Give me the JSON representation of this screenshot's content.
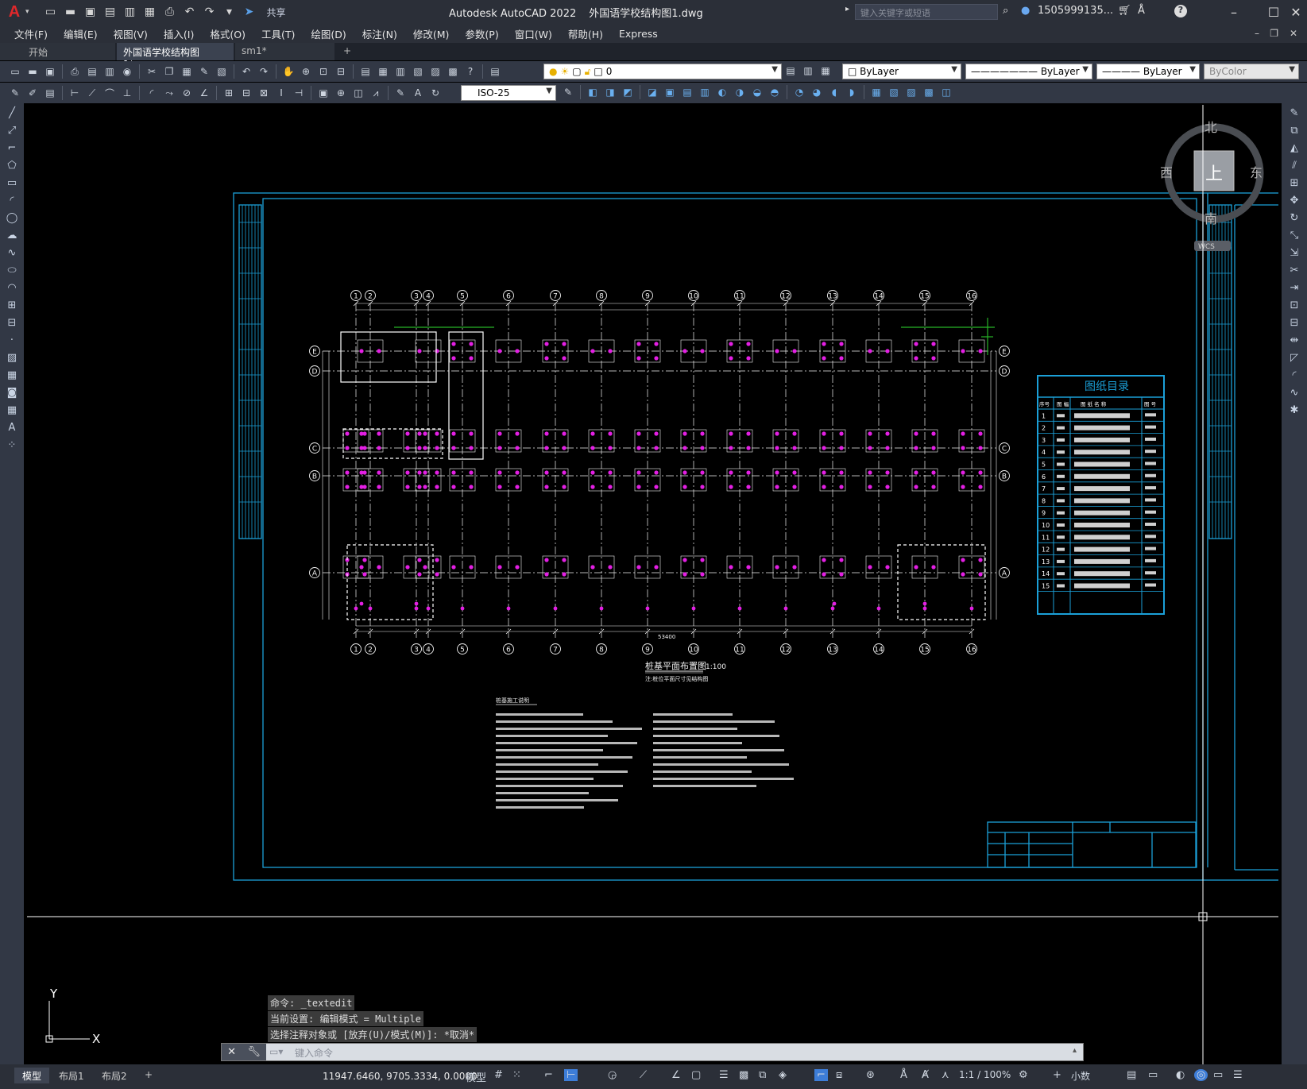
{
  "app": {
    "name": "Autodesk AutoCAD 2022",
    "file": "外国语学校结构图1.dwg",
    "logo": "A",
    "share_label": "共享",
    "search_placeholder": "键入关键字或短语",
    "user": "1505999135...",
    "help": "?"
  },
  "menu": [
    "文件(F)",
    "编辑(E)",
    "视图(V)",
    "插入(I)",
    "格式(O)",
    "工具(T)",
    "绘图(D)",
    "标注(N)",
    "修改(M)",
    "参数(P)",
    "窗口(W)",
    "帮助(H)",
    "Express"
  ],
  "tabs": [
    {
      "label": "开始"
    },
    {
      "label": "外国语学校结构图1*"
    },
    {
      "label": "sm1*"
    }
  ],
  "toolbar": {
    "layer_value": "0",
    "color": "ByLayer",
    "linetype": "ByLayer",
    "lineweight": "ByLayer",
    "plotstyle": "ByColor",
    "dimstyle": "ISO-25"
  },
  "viewcube": {
    "north": "北",
    "south": "南",
    "east": "东",
    "west": "西",
    "top": "上",
    "wcs": "WCS"
  },
  "drawing": {
    "title": "桩基平面布置图",
    "scale": "1:100",
    "subtitle": "注:桩位平面尺寸见结构图",
    "grid_cols": [
      "1",
      "2",
      "3",
      "4",
      "5",
      "6",
      "7",
      "8",
      "9",
      "10",
      "11",
      "12",
      "13",
      "14",
      "15",
      "16"
    ],
    "grid_rows": [
      "E",
      "D",
      "C",
      "B",
      "A"
    ],
    "total_dim": "53400",
    "notes_title": "桩基施工说明",
    "index": {
      "title": "图纸目录",
      "headers": [
        "序号",
        "图 幅",
        "图 纸 名 称",
        "图 号"
      ],
      "rows": [
        "1",
        "2",
        "3",
        "4",
        "5",
        "6",
        "7",
        "8",
        "9",
        "10",
        "11",
        "12",
        "13",
        "14",
        "15"
      ]
    }
  },
  "command": {
    "history": [
      "命令: _textedit",
      "当前设置: 编辑模式 = Multiple",
      "选择注释对象或 [放弃(U)/模式(M)]: *取消*"
    ],
    "placeholder": "键入命令"
  },
  "ucs": {
    "x": "X",
    "y": "Y"
  },
  "status": {
    "layouts": [
      "模型",
      "布局1",
      "布局2"
    ],
    "coords": "11947.6460, 9705.3334, 0.0000",
    "mode": "模型",
    "scale": "1:1 / 100%",
    "units": "小数"
  },
  "colors": {
    "frame": "#1ba0d8",
    "pile": "#e41fe4",
    "grid": "#f2f2f2",
    "accent": "#27b327"
  }
}
